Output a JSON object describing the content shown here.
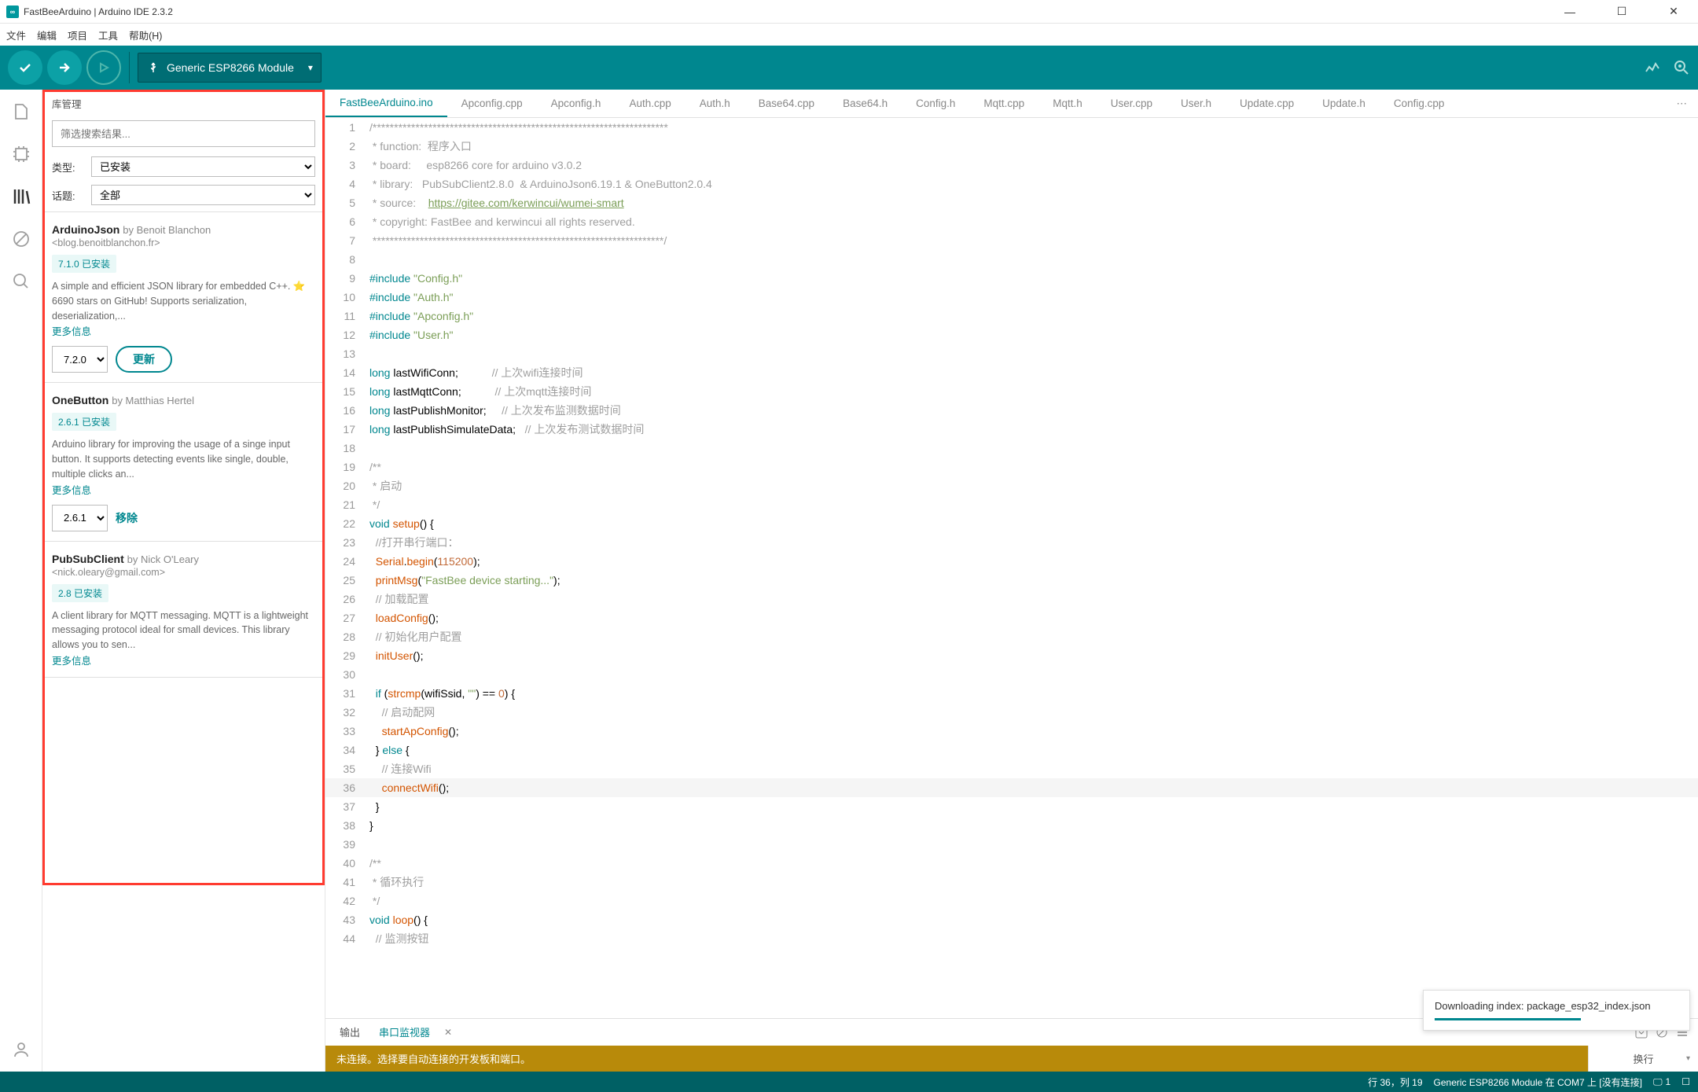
{
  "titlebar": {
    "title": "FastBeeArduino | Arduino IDE 2.3.2",
    "icon_letter": "∞"
  },
  "menu": [
    "文件",
    "编辑",
    "项目",
    "工具",
    "帮助(H)"
  ],
  "toolbar": {
    "board": "Generic ESP8266 Module"
  },
  "sidebar": {
    "header": "库管理",
    "search_placeholder": "筛选搜索结果...",
    "type_label": "类型:",
    "type_value": "已安装",
    "topic_label": "话题:",
    "topic_value": "全部",
    "more": "更多信息",
    "update": "更新",
    "remove": "移除",
    "libs": [
      {
        "name": "ArduinoJson",
        "by": "by Benoit Blanchon",
        "sub": "<blog.benoitblanchon.fr>",
        "badge": "7.1.0 已安装",
        "desc": "A simple and efficient JSON library for embedded C++. ⭐ 6690 stars on GitHub! Supports serialization, deserialization,...",
        "ver": "7.2.0",
        "action": "update"
      },
      {
        "name": "OneButton",
        "by": "by Matthias Hertel",
        "sub": "",
        "badge": "2.6.1 已安装",
        "desc": "Arduino library for improving the usage of a singe input button. It supports detecting events like single, double, multiple clicks an...",
        "ver": "2.6.1",
        "action": "remove"
      },
      {
        "name": "PubSubClient",
        "by": "by Nick O'Leary",
        "sub": "<nick.oleary@gmail.com>",
        "badge": "2.8 已安装",
        "desc": "A client library for MQTT messaging. MQTT is a lightweight messaging protocol ideal for small devices. This library allows you to sen...",
        "ver": "",
        "action": ""
      }
    ]
  },
  "tabs": [
    "FastBeeArduino.ino",
    "Apconfig.cpp",
    "Apconfig.h",
    "Auth.cpp",
    "Auth.h",
    "Base64.cpp",
    "Base64.h",
    "Config.h",
    "Mqtt.cpp",
    "Mqtt.h",
    "User.cpp",
    "User.h",
    "Update.cpp",
    "Update.h",
    "Config.cpp"
  ],
  "code_lines": [
    {
      "n": 1,
      "raw": "/*********************************************************************"
    },
    {
      "n": 2,
      "raw": " * function:  程序入口"
    },
    {
      "n": 3,
      "raw": " * board:     esp8266 core for arduino v3.0.2"
    },
    {
      "n": 4,
      "raw": " * library:   PubSubClient2.8.0  & ArduinoJson6.19.1 & OneButton2.0.4"
    },
    {
      "n": 5,
      "raw": " * source:    ",
      "link": "https://gitee.com/kerwincui/wumei-smart"
    },
    {
      "n": 6,
      "raw": " * copyright: FastBee and kerwincui all rights reserved."
    },
    {
      "n": 7,
      "raw": " ********************************************************************/"
    }
  ],
  "bottom": {
    "out_tab": "输出",
    "mon_tab": "串口监视器",
    "warn": "未连接。选择要自动连接的开发板和端口。",
    "line_end": "换行"
  },
  "toast": {
    "text": "Downloading index: package_esp32_index.json"
  },
  "status": {
    "cursor": "行 36，列 19",
    "board": "Generic ESP8266 Module 在 COM7 上 [没有连接]",
    "notif": "1"
  }
}
